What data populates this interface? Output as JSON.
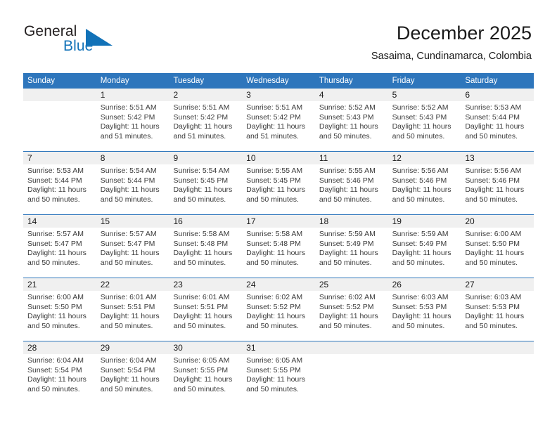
{
  "brand": {
    "line1": "General",
    "line2": "Blue",
    "mark": "triangle-logo"
  },
  "header": {
    "title": "December 2025",
    "subtitle": "Sasaima, Cundinamarca, Colombia"
  },
  "colors": {
    "header_blue": "#2e76bc",
    "daynum_band": "#f0f0f0",
    "brand_blue": "#1272b8",
    "text": "#1a1a1a"
  },
  "weekdays": [
    "Sunday",
    "Monday",
    "Tuesday",
    "Wednesday",
    "Thursday",
    "Friday",
    "Saturday"
  ],
  "weeks": [
    [
      {
        "day": "",
        "sunrise": "",
        "sunset": "",
        "daylight": ""
      },
      {
        "day": "1",
        "sunrise": "Sunrise: 5:51 AM",
        "sunset": "Sunset: 5:42 PM",
        "daylight": "Daylight: 11 hours and 51 minutes."
      },
      {
        "day": "2",
        "sunrise": "Sunrise: 5:51 AM",
        "sunset": "Sunset: 5:42 PM",
        "daylight": "Daylight: 11 hours and 51 minutes."
      },
      {
        "day": "3",
        "sunrise": "Sunrise: 5:51 AM",
        "sunset": "Sunset: 5:42 PM",
        "daylight": "Daylight: 11 hours and 51 minutes."
      },
      {
        "day": "4",
        "sunrise": "Sunrise: 5:52 AM",
        "sunset": "Sunset: 5:43 PM",
        "daylight": "Daylight: 11 hours and 50 minutes."
      },
      {
        "day": "5",
        "sunrise": "Sunrise: 5:52 AM",
        "sunset": "Sunset: 5:43 PM",
        "daylight": "Daylight: 11 hours and 50 minutes."
      },
      {
        "day": "6",
        "sunrise": "Sunrise: 5:53 AM",
        "sunset": "Sunset: 5:44 PM",
        "daylight": "Daylight: 11 hours and 50 minutes."
      }
    ],
    [
      {
        "day": "7",
        "sunrise": "Sunrise: 5:53 AM",
        "sunset": "Sunset: 5:44 PM",
        "daylight": "Daylight: 11 hours and 50 minutes."
      },
      {
        "day": "8",
        "sunrise": "Sunrise: 5:54 AM",
        "sunset": "Sunset: 5:44 PM",
        "daylight": "Daylight: 11 hours and 50 minutes."
      },
      {
        "day": "9",
        "sunrise": "Sunrise: 5:54 AM",
        "sunset": "Sunset: 5:45 PM",
        "daylight": "Daylight: 11 hours and 50 minutes."
      },
      {
        "day": "10",
        "sunrise": "Sunrise: 5:55 AM",
        "sunset": "Sunset: 5:45 PM",
        "daylight": "Daylight: 11 hours and 50 minutes."
      },
      {
        "day": "11",
        "sunrise": "Sunrise: 5:55 AM",
        "sunset": "Sunset: 5:46 PM",
        "daylight": "Daylight: 11 hours and 50 minutes."
      },
      {
        "day": "12",
        "sunrise": "Sunrise: 5:56 AM",
        "sunset": "Sunset: 5:46 PM",
        "daylight": "Daylight: 11 hours and 50 minutes."
      },
      {
        "day": "13",
        "sunrise": "Sunrise: 5:56 AM",
        "sunset": "Sunset: 5:46 PM",
        "daylight": "Daylight: 11 hours and 50 minutes."
      }
    ],
    [
      {
        "day": "14",
        "sunrise": "Sunrise: 5:57 AM",
        "sunset": "Sunset: 5:47 PM",
        "daylight": "Daylight: 11 hours and 50 minutes."
      },
      {
        "day": "15",
        "sunrise": "Sunrise: 5:57 AM",
        "sunset": "Sunset: 5:47 PM",
        "daylight": "Daylight: 11 hours and 50 minutes."
      },
      {
        "day": "16",
        "sunrise": "Sunrise: 5:58 AM",
        "sunset": "Sunset: 5:48 PM",
        "daylight": "Daylight: 11 hours and 50 minutes."
      },
      {
        "day": "17",
        "sunrise": "Sunrise: 5:58 AM",
        "sunset": "Sunset: 5:48 PM",
        "daylight": "Daylight: 11 hours and 50 minutes."
      },
      {
        "day": "18",
        "sunrise": "Sunrise: 5:59 AM",
        "sunset": "Sunset: 5:49 PM",
        "daylight": "Daylight: 11 hours and 50 minutes."
      },
      {
        "day": "19",
        "sunrise": "Sunrise: 5:59 AM",
        "sunset": "Sunset: 5:49 PM",
        "daylight": "Daylight: 11 hours and 50 minutes."
      },
      {
        "day": "20",
        "sunrise": "Sunrise: 6:00 AM",
        "sunset": "Sunset: 5:50 PM",
        "daylight": "Daylight: 11 hours and 50 minutes."
      }
    ],
    [
      {
        "day": "21",
        "sunrise": "Sunrise: 6:00 AM",
        "sunset": "Sunset: 5:50 PM",
        "daylight": "Daylight: 11 hours and 50 minutes."
      },
      {
        "day": "22",
        "sunrise": "Sunrise: 6:01 AM",
        "sunset": "Sunset: 5:51 PM",
        "daylight": "Daylight: 11 hours and 50 minutes."
      },
      {
        "day": "23",
        "sunrise": "Sunrise: 6:01 AM",
        "sunset": "Sunset: 5:51 PM",
        "daylight": "Daylight: 11 hours and 50 minutes."
      },
      {
        "day": "24",
        "sunrise": "Sunrise: 6:02 AM",
        "sunset": "Sunset: 5:52 PM",
        "daylight": "Daylight: 11 hours and 50 minutes."
      },
      {
        "day": "25",
        "sunrise": "Sunrise: 6:02 AM",
        "sunset": "Sunset: 5:52 PM",
        "daylight": "Daylight: 11 hours and 50 minutes."
      },
      {
        "day": "26",
        "sunrise": "Sunrise: 6:03 AM",
        "sunset": "Sunset: 5:53 PM",
        "daylight": "Daylight: 11 hours and 50 minutes."
      },
      {
        "day": "27",
        "sunrise": "Sunrise: 6:03 AM",
        "sunset": "Sunset: 5:53 PM",
        "daylight": "Daylight: 11 hours and 50 minutes."
      }
    ],
    [
      {
        "day": "28",
        "sunrise": "Sunrise: 6:04 AM",
        "sunset": "Sunset: 5:54 PM",
        "daylight": "Daylight: 11 hours and 50 minutes."
      },
      {
        "day": "29",
        "sunrise": "Sunrise: 6:04 AM",
        "sunset": "Sunset: 5:54 PM",
        "daylight": "Daylight: 11 hours and 50 minutes."
      },
      {
        "day": "30",
        "sunrise": "Sunrise: 6:05 AM",
        "sunset": "Sunset: 5:55 PM",
        "daylight": "Daylight: 11 hours and 50 minutes."
      },
      {
        "day": "31",
        "sunrise": "Sunrise: 6:05 AM",
        "sunset": "Sunset: 5:55 PM",
        "daylight": "Daylight: 11 hours and 50 minutes."
      },
      {
        "day": "",
        "sunrise": "",
        "sunset": "",
        "daylight": ""
      },
      {
        "day": "",
        "sunrise": "",
        "sunset": "",
        "daylight": ""
      },
      {
        "day": "",
        "sunrise": "",
        "sunset": "",
        "daylight": ""
      }
    ]
  ]
}
